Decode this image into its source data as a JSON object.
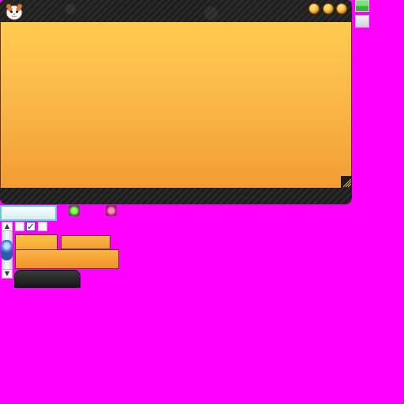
{
  "window": {
    "title_bar": {
      "app_icon": "hamster-icon",
      "controls": [
        "minimize-orb",
        "maximize-orb",
        "close-orb"
      ],
      "control_color": "#f4a620"
    },
    "client_area": {
      "gradient_top": "#ffcb4f",
      "gradient_bottom": "#f39d34"
    },
    "resize_grip": "resize-grip-icon",
    "frame_color": "#1e1e1e"
  },
  "side_chips": [
    "green-state-chip",
    "gray-state-chip"
  ],
  "widgets": {
    "textbox_value": "",
    "led_indicators": [
      {
        "name": "green-led",
        "color": "#2f9a12"
      },
      {
        "name": "red-led",
        "color": "#d01c6a"
      }
    ],
    "scrollbar": {
      "up_arrow": "▲",
      "down_arrow": "▼"
    },
    "checkboxes": [
      {
        "state": "unchecked",
        "glyph": ""
      },
      {
        "state": "checked",
        "glyph": "✓"
      },
      {
        "state": "unchecked",
        "glyph": ""
      }
    ]
  },
  "colors": {
    "background_key": "#ff00ff",
    "accent": "#f4a620"
  }
}
